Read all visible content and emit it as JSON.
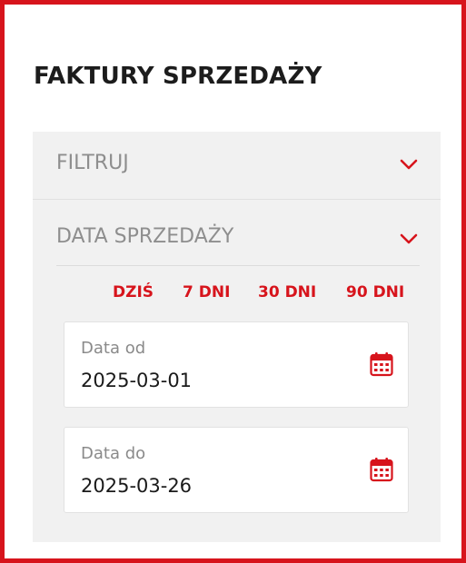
{
  "page": {
    "title": "FAKTURY SPRZEDAŻY"
  },
  "filter": {
    "label": "FILTRUJ"
  },
  "date_section": {
    "label": "DATA SPRZEDAŻY",
    "quick_ranges": [
      "DZIŚ",
      "7 DNI",
      "30 DNI",
      "90 DNI"
    ]
  },
  "date_from": {
    "label": "Data od",
    "value": "2025-03-01"
  },
  "date_to": {
    "label": "Data do",
    "value": "2025-03-26"
  },
  "colors": {
    "accent": "#d7141c",
    "panel": "#f1f1f1"
  },
  "icons": {
    "chevron": "chevron-down-icon",
    "calendar": "calendar-icon"
  }
}
